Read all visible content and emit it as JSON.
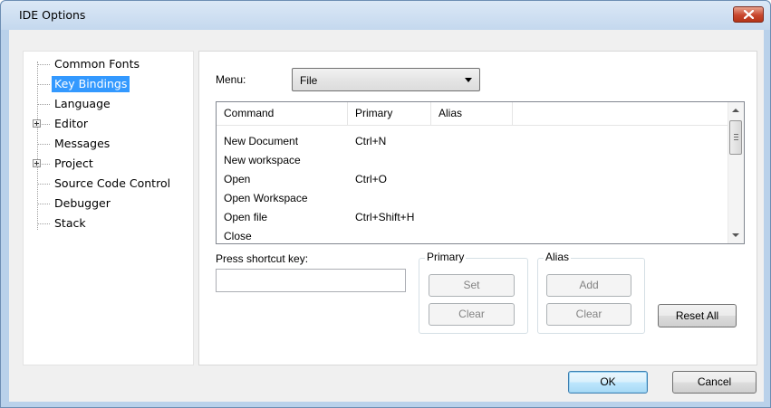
{
  "window": {
    "title": "IDE Options"
  },
  "tree": {
    "items": [
      {
        "label": "Common Fonts"
      },
      {
        "label": "Key Bindings"
      },
      {
        "label": "Language"
      },
      {
        "label": "Editor"
      },
      {
        "label": "Messages"
      },
      {
        "label": "Project"
      },
      {
        "label": "Source Code Control"
      },
      {
        "label": "Debugger"
      },
      {
        "label": "Stack"
      }
    ],
    "selected": "Key Bindings"
  },
  "menu": {
    "label": "Menu:",
    "selected": "File"
  },
  "commands": {
    "columns": [
      "Command",
      "Primary",
      "Alias"
    ],
    "rows": [
      {
        "command": "New Document",
        "primary": "Ctrl+N",
        "alias": ""
      },
      {
        "command": "New workspace",
        "primary": "",
        "alias": ""
      },
      {
        "command": "Open",
        "primary": "Ctrl+O",
        "alias": ""
      },
      {
        "command": "Open Workspace",
        "primary": "",
        "alias": ""
      },
      {
        "command": "Open file",
        "primary": "Ctrl+Shift+H",
        "alias": ""
      },
      {
        "command": "Close",
        "primary": "",
        "alias": ""
      }
    ]
  },
  "shortcut": {
    "label": "Press shortcut key:",
    "value": ""
  },
  "primary_group": {
    "title": "Primary",
    "set_label": "Set",
    "clear_label": "Clear"
  },
  "alias_group": {
    "title": "Alias",
    "add_label": "Add",
    "clear_label": "Clear"
  },
  "reset_all_label": "Reset All",
  "footer": {
    "ok_label": "OK",
    "cancel_label": "Cancel"
  }
}
